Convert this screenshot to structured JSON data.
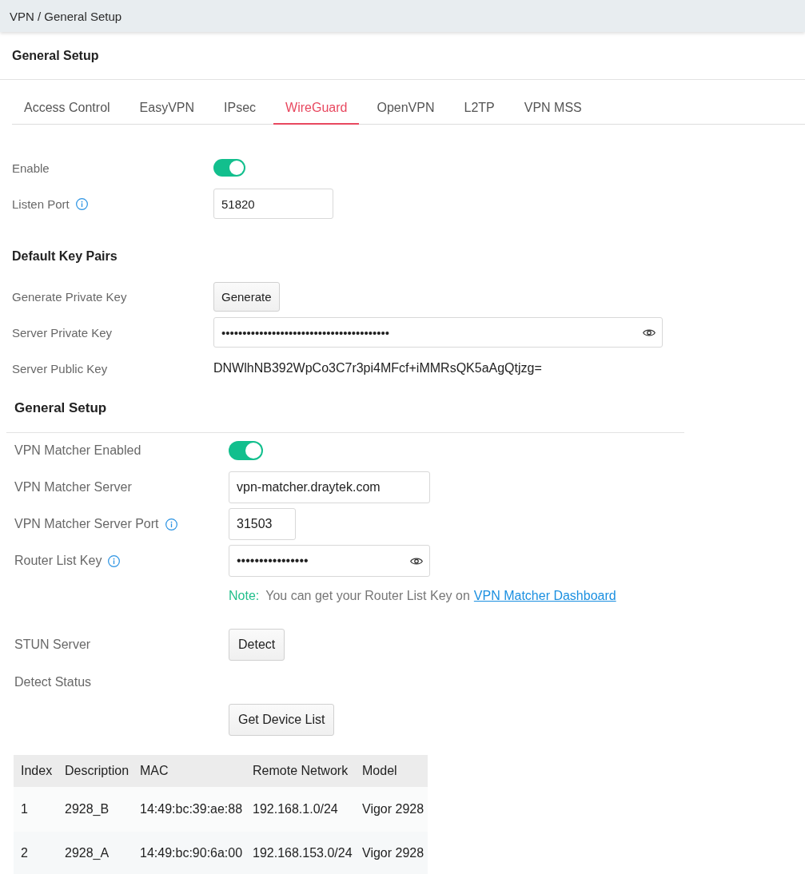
{
  "breadcrumb": "VPN / General Setup",
  "title": "General Setup",
  "tabs": [
    {
      "label": "Access Control",
      "selected": false
    },
    {
      "label": "EasyVPN",
      "selected": false
    },
    {
      "label": "IPsec",
      "selected": false
    },
    {
      "label": "WireGuard",
      "selected": true
    },
    {
      "label": "OpenVPN",
      "selected": false
    },
    {
      "label": "L2TP",
      "selected": false
    },
    {
      "label": "VPN MSS",
      "selected": false
    }
  ],
  "settings": [
    {
      "kind": "toggle",
      "label": "Enable",
      "on": true
    },
    {
      "kind": "input",
      "label": "Listen Port",
      "info": true,
      "value": "51820"
    }
  ],
  "key_pairs": {
    "heading": "Default Key Pairs",
    "rows": [
      {
        "kind": "button",
        "label": "Generate Private Key",
        "button": "Generate"
      },
      {
        "kind": "password",
        "label": "Server Private Key",
        "value": "••••••••••••••••••••••••••••••••••••••••"
      },
      {
        "kind": "text",
        "label": "Server Public Key",
        "value": "DNWlhNB392WpCo3C7r3pi4MFcf+iMMRsQK5aAgQtjzg="
      }
    ]
  },
  "general_setup": {
    "heading": "General Setup",
    "rows": [
      {
        "kind": "toggle",
        "label": "VPN Matcher Enabled",
        "on": true
      },
      {
        "kind": "input",
        "label": "VPN Matcher Server",
        "value": "vpn-matcher.draytek.com"
      },
      {
        "kind": "input",
        "label": "VPN Matcher Server Port",
        "info": true,
        "value": "31503"
      },
      {
        "kind": "password",
        "label": "Router List Key",
        "info": true,
        "value": "••••••••••••••••"
      },
      {
        "kind": "note",
        "label": "Note:",
        "text": "You can get your Router List Key on",
        "link": "VPN Matcher Dashboard"
      },
      {
        "kind": "button",
        "label": "STUN Server",
        "button": "Detect"
      },
      {
        "kind": "text",
        "label": "Detect Status"
      },
      {
        "kind": "button",
        "button": "Get Device List"
      }
    ]
  },
  "device_table": {
    "columns": [
      "Index",
      "Description",
      "MAC",
      "Remote Network",
      "Model"
    ],
    "rows": [
      [
        "1",
        "2928_B",
        "14:49:bc:39:ae:88",
        "192.168.1.0/24",
        "Vigor 2928"
      ],
      [
        "2",
        "2928_A",
        "14:49:bc:90:6a:00",
        "192.168.153.0/24",
        "Vigor 2928"
      ]
    ]
  }
}
